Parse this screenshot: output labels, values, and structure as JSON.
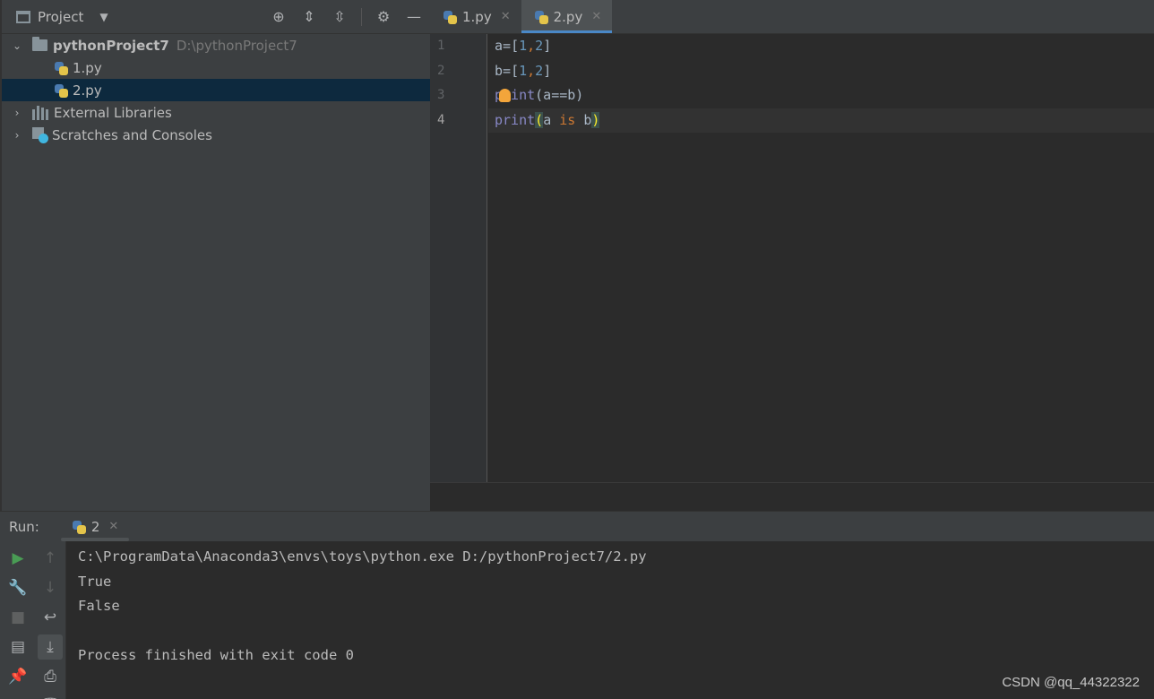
{
  "project_panel": {
    "title": "Project",
    "tree": [
      {
        "label": "pythonProject7",
        "path": "D:\\pythonProject7"
      },
      {
        "label": "1.py"
      },
      {
        "label": "2.py"
      },
      {
        "label": "External Libraries"
      },
      {
        "label": "Scratches and Consoles"
      }
    ]
  },
  "editor": {
    "tabs": [
      {
        "label": "1.py"
      },
      {
        "label": "2.py"
      }
    ],
    "line_numbers": [
      "1",
      "2",
      "3",
      "4"
    ],
    "code": {
      "l1": {
        "a": "a",
        "eq": "=",
        "lb": "[",
        "n1": "1",
        "comma": ",",
        "n2": "2",
        "rb": "]"
      },
      "l2": {
        "a": "b",
        "eq": "=",
        "lb": "[",
        "n1": "1",
        "comma": ",",
        "n2": "2",
        "rb": "]"
      },
      "l3": {
        "fn": "print",
        "rest": "(a==b)"
      },
      "l4": {
        "fn": "print",
        "lp": "(",
        "a": "a ",
        "kw": "is",
        "b": " b",
        "rp": ")"
      }
    }
  },
  "run_panel": {
    "label": "Run:",
    "tab": "2",
    "console": [
      "C:\\ProgramData\\Anaconda3\\envs\\toys\\python.exe D:/pythonProject7/2.py",
      "True",
      "False",
      "",
      "Process finished with exit code 0"
    ]
  },
  "watermark": "CSDN @qq_44322322",
  "colors": {
    "accent": "#4a88c7",
    "selection": "#0d293e",
    "run_green": "#499c54",
    "keyword": "#cc7832",
    "number": "#6897bb"
  }
}
